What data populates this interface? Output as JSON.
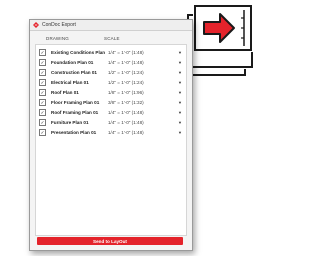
{
  "app": {
    "title": "ConDoc Export"
  },
  "columns": {
    "drawing": "DRAWING",
    "scale": "SCALE"
  },
  "rows": [
    {
      "name": "Existing Conditions Plan 01",
      "scale": "1/4\" = 1'-0\" (1:48)",
      "checked": true
    },
    {
      "name": "Foundation Plan 01",
      "scale": "1/4\" = 1'-0\" (1:48)",
      "checked": true
    },
    {
      "name": "Construction Plan 01",
      "scale": "1/2\" = 1'-0\" (1:24)",
      "checked": true
    },
    {
      "name": "Electrical Plan 01",
      "scale": "1/2\" = 1'-0\" (1:24)",
      "checked": true
    },
    {
      "name": "Roof Plan 01",
      "scale": "1/8\" = 1'-0\" (1:96)",
      "checked": true
    },
    {
      "name": "Floor Framing Plan 01",
      "scale": "3/8\" = 1'-0\" (1:32)",
      "checked": true
    },
    {
      "name": "Roof Framing Plan 01",
      "scale": "1/4\" = 1'-0\" (1:48)",
      "checked": true
    },
    {
      "name": "Furniture Plan 01",
      "scale": "1/4\" = 1'-0\" (1:48)",
      "checked": true
    },
    {
      "name": "Presentation Plan 01",
      "scale": "1/4\" = 1'-0\" (1:48)",
      "checked": true
    }
  ],
  "actions": {
    "send_label": "Send to LayOut"
  },
  "colors": {
    "accent": "#e4232b",
    "icon_arrow": "#e4232b"
  },
  "icons": {
    "title": "condoc-logo-icon",
    "stack": "export-to-layout-icon",
    "dropdown": "chevron-down-icon"
  }
}
